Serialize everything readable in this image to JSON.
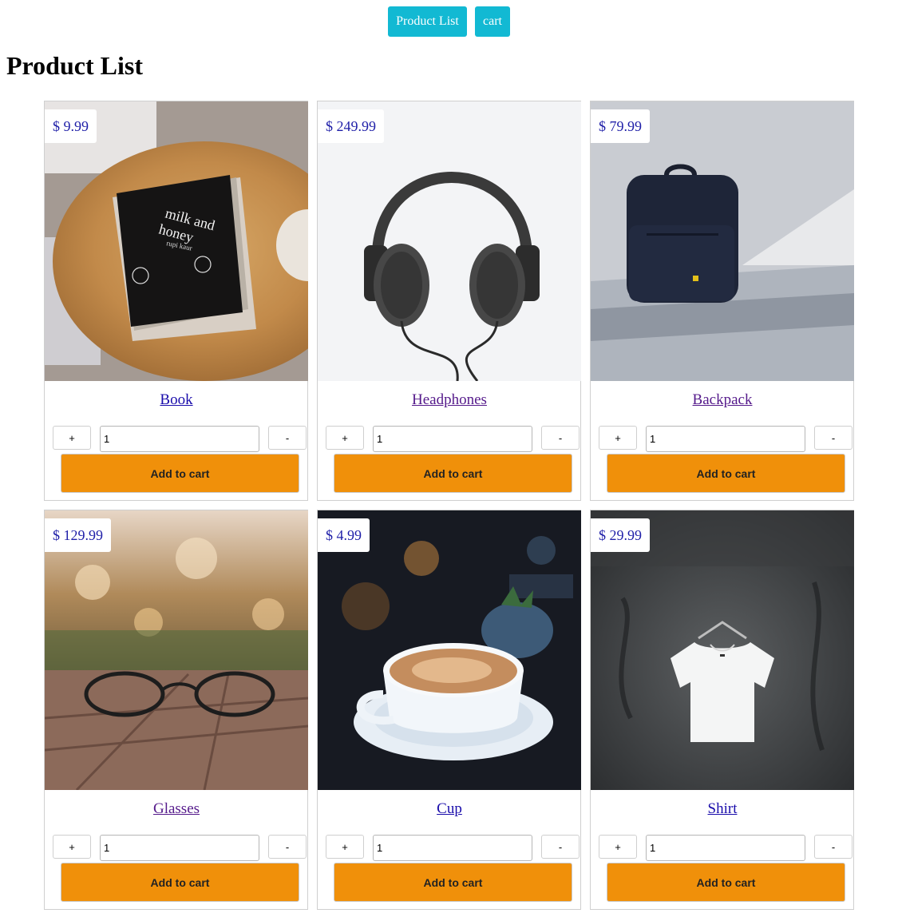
{
  "nav": {
    "product_list_label": "Product List",
    "cart_label": "cart"
  },
  "page": {
    "title": "Product List"
  },
  "products": [
    {
      "name": "Book",
      "price": "$ 9.99",
      "quantity": "1",
      "plus": "+",
      "minus": "-",
      "add_label": "Add to cart",
      "image": "book-photo"
    },
    {
      "name": "Headphones",
      "price": "$ 249.99",
      "quantity": "1",
      "plus": "+",
      "minus": "-",
      "add_label": "Add to cart",
      "image": "headphones-photo"
    },
    {
      "name": "Backpack",
      "price": "$ 79.99",
      "quantity": "1",
      "plus": "+",
      "minus": "-",
      "add_label": "Add to cart",
      "image": "backpack-photo"
    },
    {
      "name": "Glasses",
      "price": "$ 129.99",
      "quantity": "1",
      "plus": "+",
      "minus": "-",
      "add_label": "Add to cart",
      "image": "glasses-photo"
    },
    {
      "name": "Cup",
      "price": "$ 4.99",
      "quantity": "1",
      "plus": "+",
      "minus": "-",
      "add_label": "Add to cart",
      "image": "cup-photo"
    },
    {
      "name": "Shirt",
      "price": "$ 29.99",
      "quantity": "1",
      "plus": "+",
      "minus": "-",
      "add_label": "Add to cart",
      "image": "shirt-photo"
    }
  ],
  "colors": {
    "nav_button": "#12b9d3",
    "add_button": "#f0900a",
    "price_text": "#1f1fa8",
    "link": "#1a0dab"
  }
}
